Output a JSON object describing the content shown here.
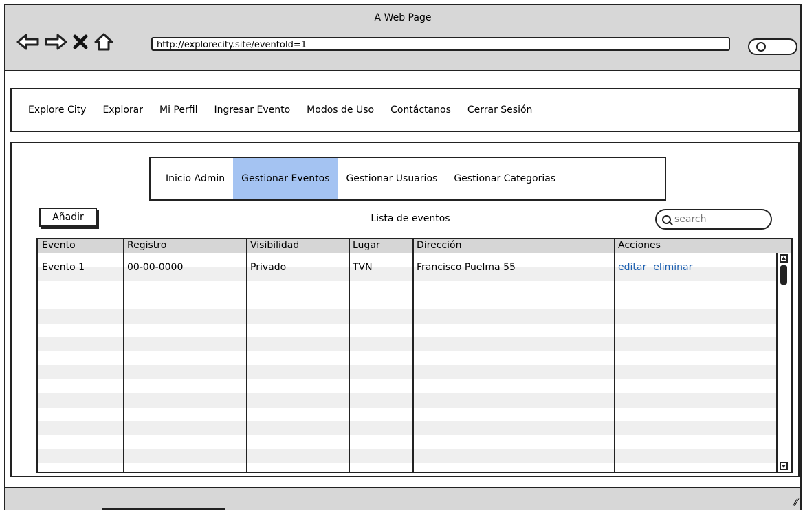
{
  "window": {
    "title": "A Web Page"
  },
  "browser": {
    "url": "http://explorecity.site/eventoId=1",
    "nav_icons": [
      "back-arrow-icon",
      "forward-arrow-icon",
      "stop-x-icon",
      "home-icon"
    ]
  },
  "topnav": {
    "items": [
      {
        "label": "Explore City"
      },
      {
        "label": "Explorar"
      },
      {
        "label": "Mi Perfil"
      },
      {
        "label": "Ingresar Evento"
      },
      {
        "label": "Modos de Uso"
      },
      {
        "label": "Contáctanos"
      },
      {
        "label": "Cerrar Sesión"
      }
    ]
  },
  "admin_tabs": {
    "items": [
      {
        "label": "Inicio Admin",
        "active": false
      },
      {
        "label": "Gestionar Eventos",
        "active": true
      },
      {
        "label": "Gestionar Usuarios",
        "active": false
      },
      {
        "label": "Gestionar Categorias",
        "active": false
      }
    ],
    "active_color": "#a4c3f2"
  },
  "toolbar": {
    "add_label": "Añadir",
    "list_title": "Lista de eventos",
    "search_placeholder": "search"
  },
  "table": {
    "columns": [
      "Evento",
      "Registro",
      "Visibilidad",
      "Lugar",
      "Dirección",
      "Acciones"
    ],
    "rows": [
      {
        "evento": "Evento 1",
        "registro": "00-00-0000",
        "visibilidad": "Privado",
        "lugar": "TVN",
        "direccion": "Francisco Puelma 55",
        "actions": [
          "editar",
          "eliminar"
        ]
      }
    ],
    "link_color": "#1c5fb0"
  }
}
